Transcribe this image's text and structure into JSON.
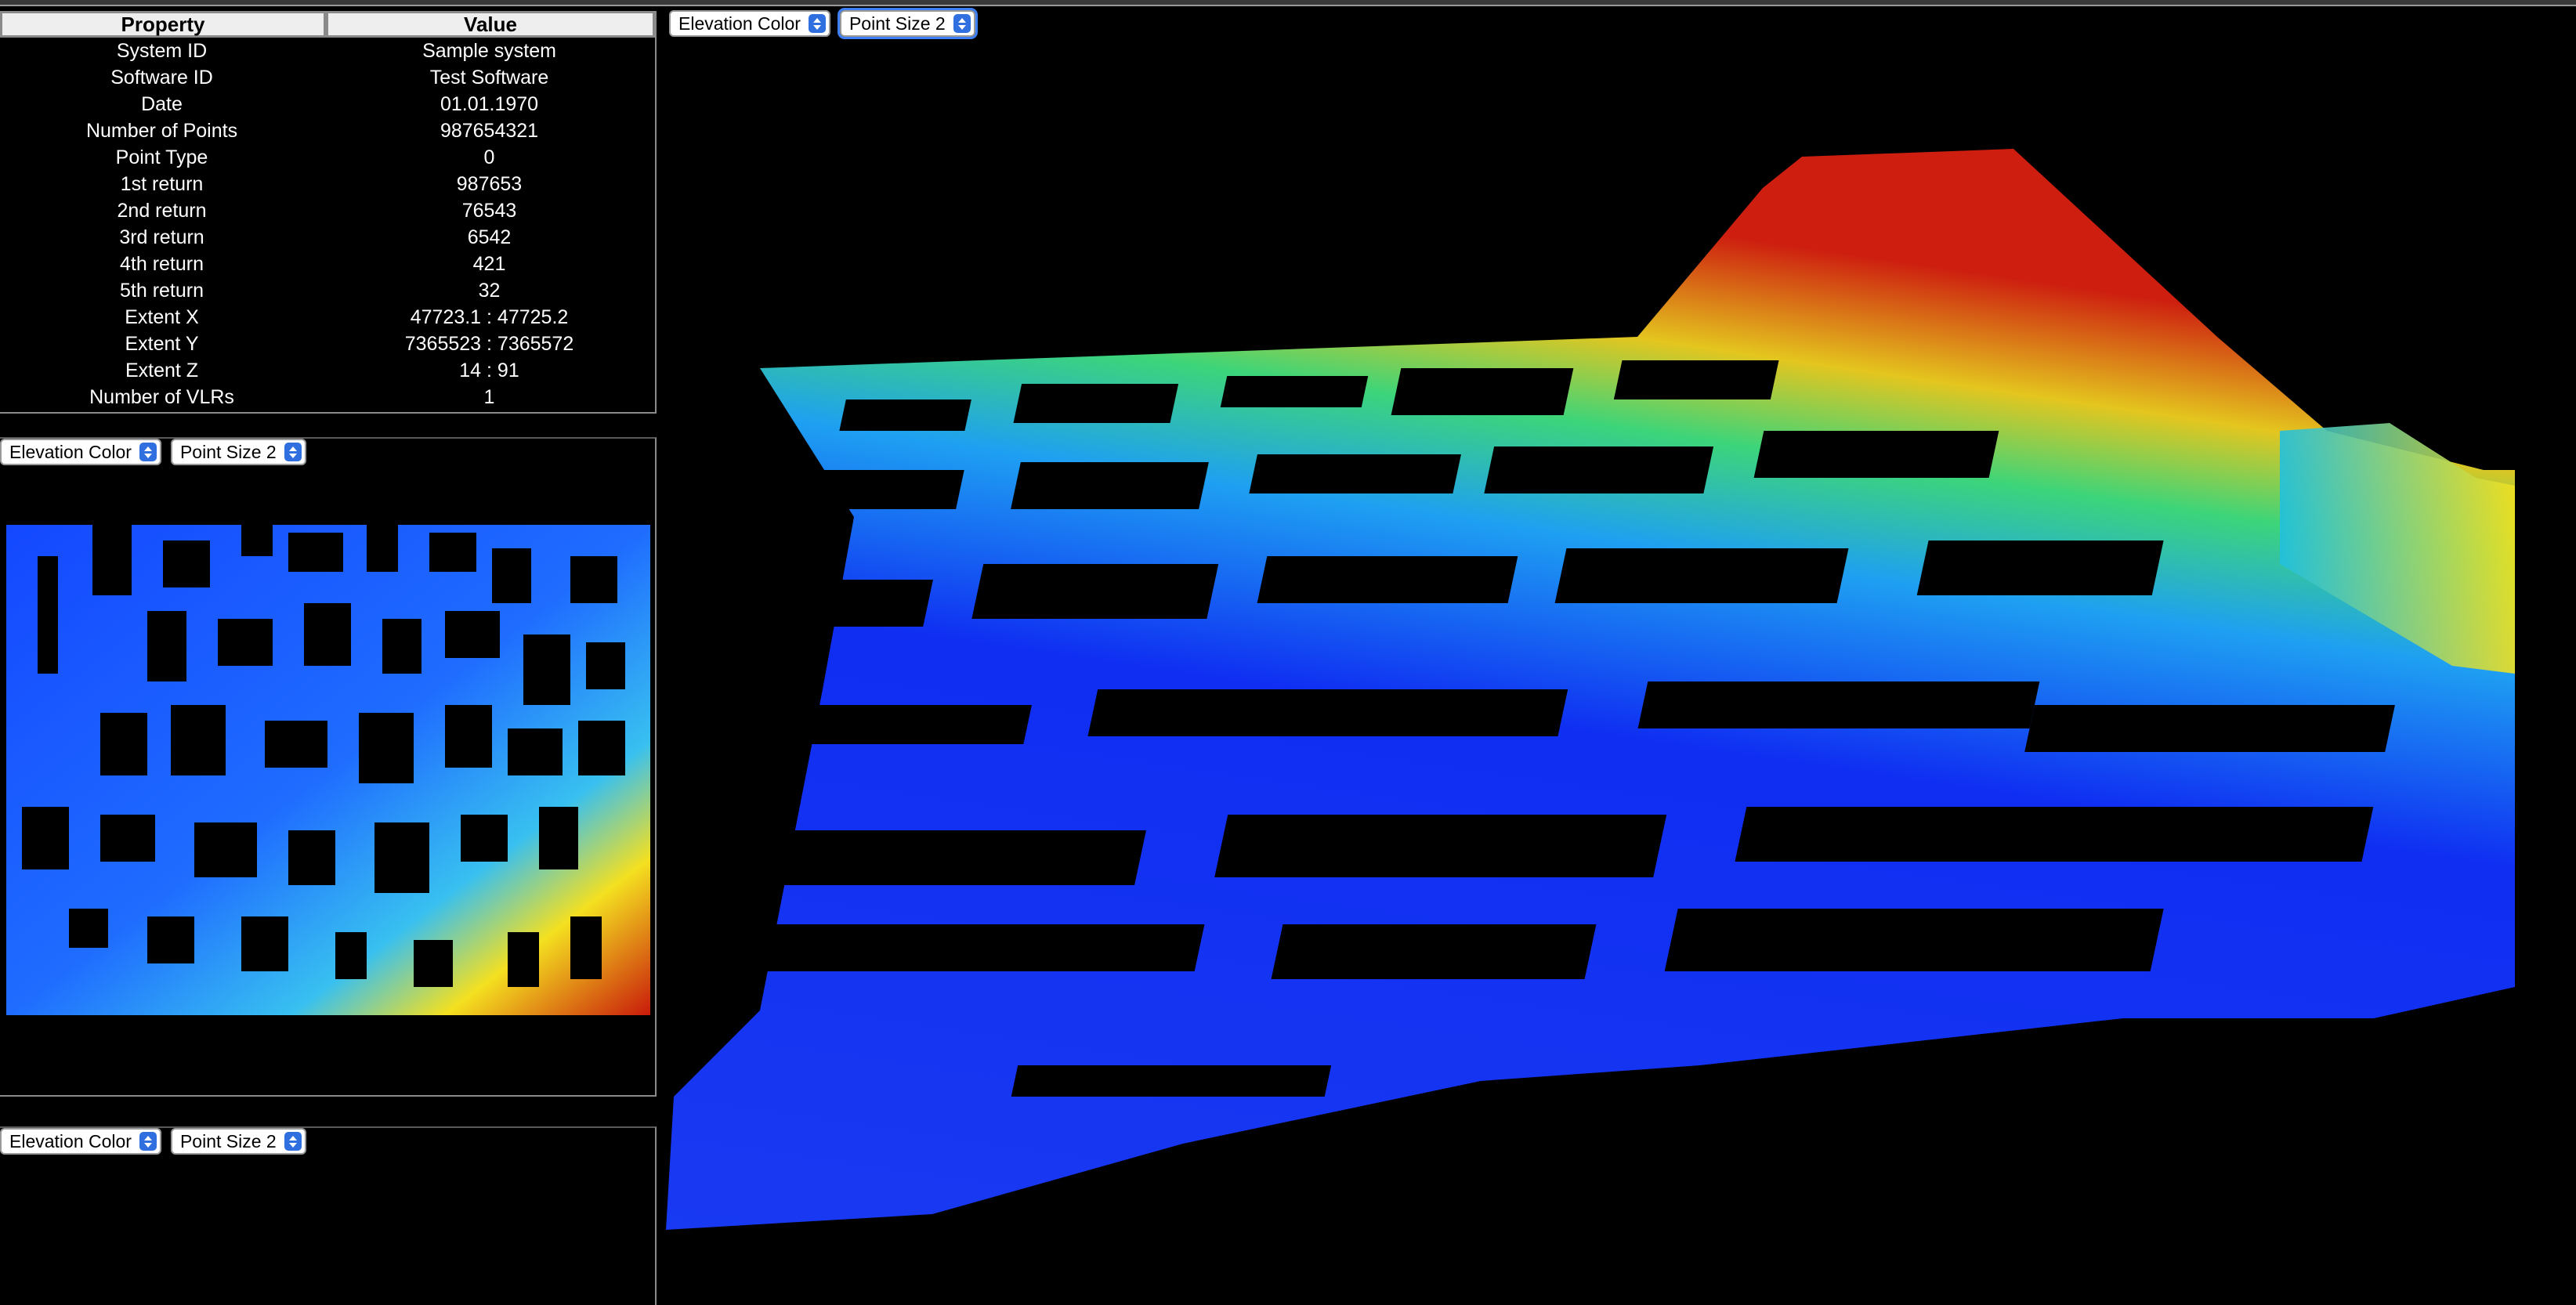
{
  "properties": {
    "header": {
      "property": "Property",
      "value": "Value"
    },
    "rows": [
      {
        "property": "System ID",
        "value": "Sample system"
      },
      {
        "property": "Software ID",
        "value": "Test Software"
      },
      {
        "property": "Date",
        "value": "01.01.1970"
      },
      {
        "property": "Number of Points",
        "value": "987654321"
      },
      {
        "property": "Point Type",
        "value": "0"
      },
      {
        "property": "1st return",
        "value": "987653"
      },
      {
        "property": "2nd return",
        "value": "76543"
      },
      {
        "property": "3rd return",
        "value": "6542"
      },
      {
        "property": "4th return",
        "value": "421"
      },
      {
        "property": "5th return",
        "value": "32"
      },
      {
        "property": "Extent X",
        "value": "47723.1 : 47725.2"
      },
      {
        "property": "Extent Y",
        "value": "7365523 : 7365572"
      },
      {
        "property": "Extent Z",
        "value": "14 : 91"
      },
      {
        "property": "Number of VLRs",
        "value": "1"
      }
    ]
  },
  "viewers": {
    "main": {
      "color_mode": "Elevation Color",
      "point_size": "Point Size 2"
    },
    "topview": {
      "color_mode": "Elevation Color",
      "point_size": "Point Size 2"
    },
    "third": {
      "color_mode": "Elevation Color",
      "point_size": "Point Size 2"
    }
  },
  "colors": {
    "background": "#000000",
    "low": "#1030ff",
    "mid": "#30c8ff",
    "high": "#d82010",
    "select_arrow": "#2f6fe0"
  },
  "icons": [
    "select-arrow-icon"
  ]
}
